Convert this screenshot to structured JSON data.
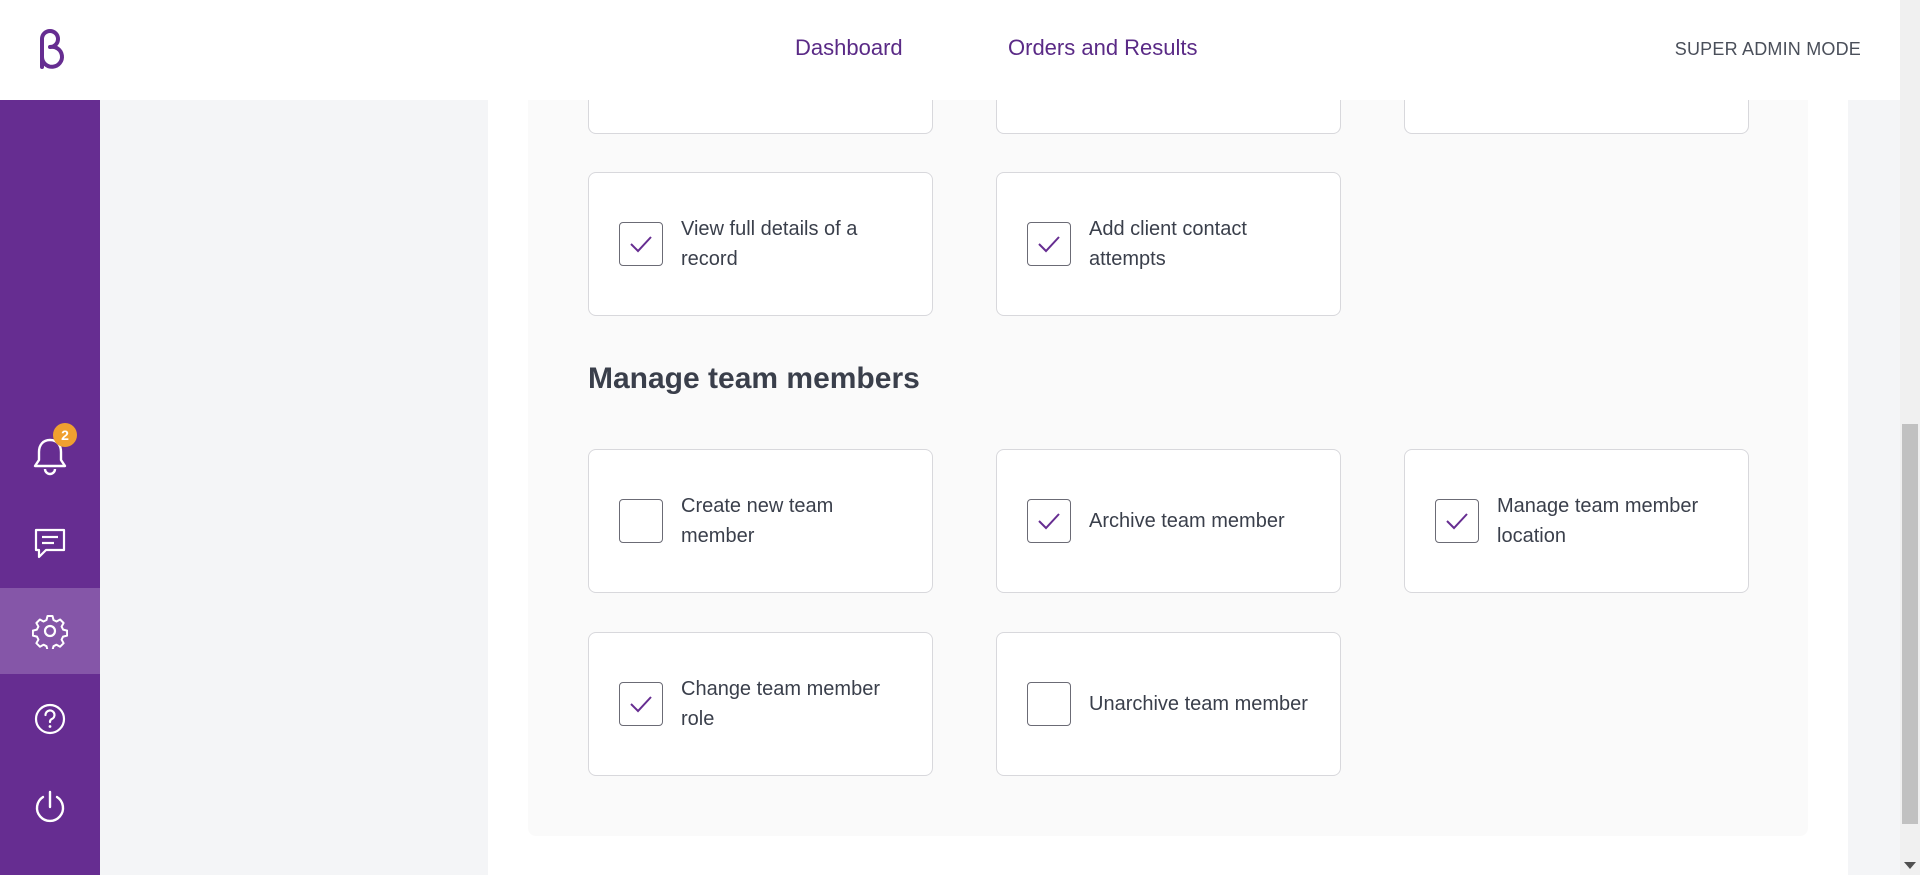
{
  "header": {
    "nav": [
      "Dashboard",
      "Orders and Results"
    ],
    "mode_label": "SUPER ADMIN MODE"
  },
  "sidebar": {
    "notification_count": "2",
    "icons": [
      "bell-icon",
      "chat-icon",
      "gear-icon",
      "help-icon",
      "power-icon"
    ],
    "active": "gear-icon"
  },
  "colors": {
    "brand_purple": "#662d91",
    "active_purple": "#8556a8",
    "badge_orange": "#f0a030",
    "link_purple": "#5a2a86"
  },
  "permissions_top": [
    {
      "label": "View full details of a record",
      "checked": true
    },
    {
      "label": "Add client contact attempts",
      "checked": true
    }
  ],
  "section": {
    "title": "Manage team members"
  },
  "team_permissions": [
    {
      "label": "Create new team member",
      "checked": false
    },
    {
      "label": "Archive team member",
      "checked": true
    },
    {
      "label": "Manage team member location",
      "checked": true
    },
    {
      "label": "Change team member role",
      "checked": true
    },
    {
      "label": "Unarchive team member",
      "checked": false
    }
  ]
}
